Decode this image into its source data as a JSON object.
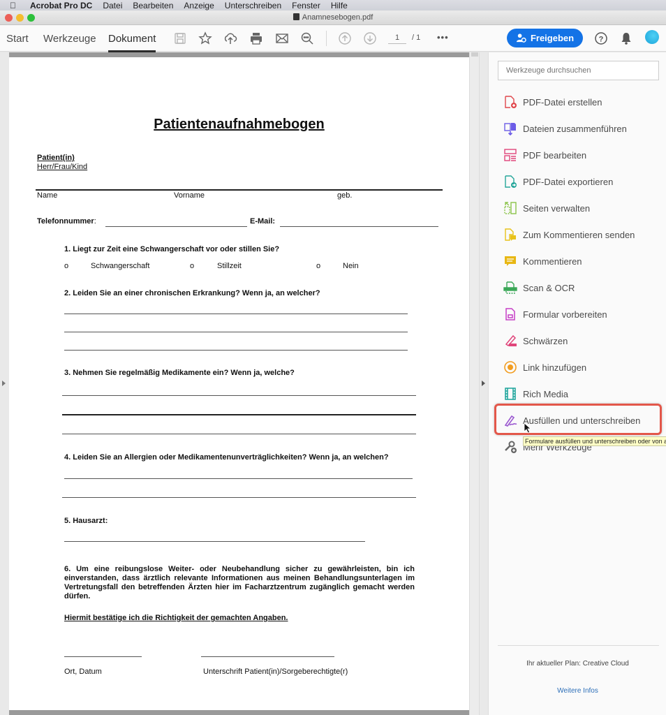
{
  "menubar": {
    "apple_icon": "apple-logo",
    "app_name": "Acrobat Pro DC",
    "items": [
      "Datei",
      "Bearbeiten",
      "Anzeige",
      "Unterschreiben",
      "Fenster",
      "Hilfe"
    ]
  },
  "window": {
    "title": "Anamnesebogen.pdf"
  },
  "toolbar": {
    "tabs": [
      {
        "label": "Start",
        "active": false
      },
      {
        "label": "Werkzeuge",
        "active": false
      },
      {
        "label": "Dokument",
        "active": true
      }
    ],
    "icons": [
      "save-icon",
      "bookmark-star-icon",
      "cloud-upload-icon",
      "print-icon",
      "mail-icon",
      "search-zoom-icon",
      "page-up-icon",
      "page-down-icon",
      "more-icon"
    ],
    "page_current": "1",
    "page_total": "/ 1",
    "more_label": "•••",
    "share_label": "Freigeben",
    "share_color": "#1473e6",
    "help_label": "?",
    "notification_icon": "bell-icon"
  },
  "document": {
    "title": "Patientenaufnahmebogen",
    "patient_label": "Patient(in)",
    "salutation": "Herr/Frau/Kind",
    "name_label": "Name",
    "firstname_label": "Vorname",
    "birth_label": "geb.",
    "phone_label": "Telefonnummer",
    "phone_colon": ":",
    "email_label": "E-Mail:",
    "q1": "1. Liegt zur Zeit eine Schwangerschaft vor oder stillen Sie?",
    "q1_options": [
      {
        "marker": "o",
        "label": "Schwangerschaft"
      },
      {
        "marker": "o",
        "label": "Stillzeit"
      },
      {
        "marker": "o",
        "label": "Nein"
      }
    ],
    "q2": "2. Leiden Sie an einer chronischen Erkrankung? Wenn ja, an welcher?",
    "q3": "3. Nehmen Sie regelmäßig Medikamente ein? Wenn ja, welche?",
    "q4": "4. Leiden Sie an Allergien oder Medikamentenunverträglichkeiten? Wenn ja, an welchen?",
    "q5": "5. Hausarzt:",
    "q6": "6. Um eine reibungslose Weiter- oder Neubehandlung sicher zu gewährleisten, bin ich einverstanden, dass ärztlich relevante Informationen aus meinen Behandlungsunterlagen im Vertretungsfall den betreffenden Ärzten hier im Facharztzentrum zugänglich gemacht werden dürfen.",
    "confirmation": "Hiermit bestätige ich die Richtigkeit der gemachten Angaben.",
    "place_date_label": "Ort, Datum",
    "signature_label": "Unterschrift Patient(in)/Sorgeberechtigte(r)"
  },
  "tools_panel": {
    "search_placeholder": "Werkzeuge durchsuchen",
    "tools": [
      {
        "label": "PDF-Datei erstellen",
        "icon": "create-pdf-icon",
        "color": "#e0474c"
      },
      {
        "label": "Dateien zusammenführen",
        "icon": "combine-files-icon",
        "color": "#6c5ce7"
      },
      {
        "label": "PDF bearbeiten",
        "icon": "edit-pdf-icon",
        "color": "#e0457b"
      },
      {
        "label": "PDF-Datei exportieren",
        "icon": "export-pdf-icon",
        "color": "#26a69a"
      },
      {
        "label": "Seiten verwalten",
        "icon": "organize-pages-icon",
        "color": "#8bc34a"
      },
      {
        "label": "Zum Kommentieren senden",
        "icon": "send-for-comments-icon",
        "color": "#e8c21a"
      },
      {
        "label": "Kommentieren",
        "icon": "comment-icon",
        "color": "#e8b714"
      },
      {
        "label": "Scan & OCR",
        "icon": "scan-icon",
        "color": "#3aa757"
      },
      {
        "label": "Formular vorbereiten",
        "icon": "prepare-form-icon",
        "color": "#c63ec6"
      },
      {
        "label": "Schwärzen",
        "icon": "redact-icon",
        "color": "#e0457b"
      },
      {
        "label": "Link hinzufügen",
        "icon": "add-link-icon",
        "color": "#f29c1f"
      },
      {
        "label": "Rich Media",
        "icon": "rich-media-icon",
        "color": "#1aa39a"
      },
      {
        "label": "Ausfüllen und unterschreiben",
        "icon": "fill-sign-icon",
        "color": "#9b59d0"
      },
      {
        "label": "Mehr Werkzeuge",
        "icon": "more-tools-icon",
        "color": "#666666"
      }
    ],
    "highlighted_tool": "Ausfüllen und unterschreiben",
    "tooltip": "Formulare ausfüllen und unterschreiben oder von a",
    "plan_text": "Ihr aktueller Plan: Creative Cloud",
    "more_info_link": "Weitere Infos"
  }
}
